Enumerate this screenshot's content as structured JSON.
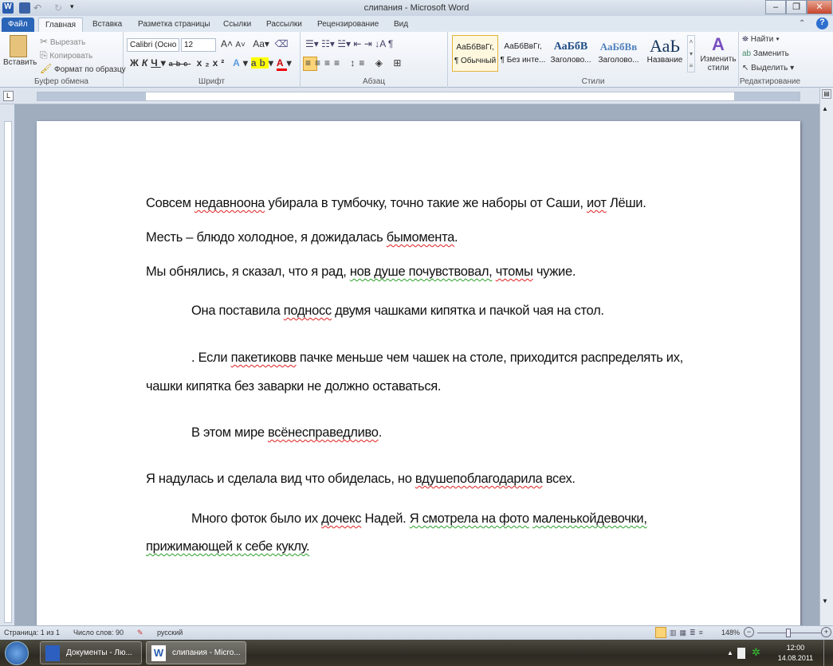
{
  "window": {
    "title": "слипания - Microsoft Word",
    "minimize": "–",
    "restore": "❐",
    "close": "✕"
  },
  "tabs": [
    "Файл",
    "Главная",
    "Вставка",
    "Разметка страницы",
    "Ссылки",
    "Рассылки",
    "Рецензирование",
    "Вид"
  ],
  "ribbon": {
    "clipboard": {
      "label": "Буфер обмена",
      "paste": "Вставить",
      "cut": "Вырезать",
      "copy": "Копировать",
      "format_painter": "Формат по образцу"
    },
    "font": {
      "label": "Шрифт",
      "font_name": "Calibri (Осно",
      "font_size": "12"
    },
    "paragraph": {
      "label": "Абзац"
    },
    "styles": {
      "label": "Стили",
      "items": [
        {
          "preview": "АаБбВвГг,",
          "name": "¶ Обычный"
        },
        {
          "preview": "АаБбВвГг,",
          "name": "¶ Без инте..."
        },
        {
          "preview": "АаБбВ",
          "name": "Заголово..."
        },
        {
          "preview": "АаБбВв",
          "name": "Заголово..."
        },
        {
          "preview": "АаЬ",
          "name": "Название"
        }
      ],
      "change_styles": "Изменить стили"
    },
    "editing": {
      "label": "Редактирование",
      "find": "Найти",
      "replace": "Заменить",
      "select": "Выделить"
    }
  },
  "document": {
    "lines": [
      {
        "indent": false,
        "segments": [
          {
            "t": "Совсем "
          },
          {
            "t": "недавноона",
            "err": "red"
          },
          {
            "t": " убирала в тумбочку, точно такие же наборы от Саши, "
          },
          {
            "t": "иот",
            "err": "red"
          },
          {
            "t": " Лёши."
          }
        ]
      },
      {
        "indent": false,
        "segments": [
          {
            "t": "Месть – блюдо холодное, я дожидалась "
          },
          {
            "t": "бымомента",
            "err": "red"
          },
          {
            "t": "."
          }
        ]
      },
      {
        "indent": false,
        "segments": [
          {
            "t": "Мы обнялись, я сказал, что я рад, "
          },
          {
            "t": "нов душе почувствовал,",
            "err": "green"
          },
          {
            "t": " "
          },
          {
            "t": "чтомы",
            "err": "red"
          },
          {
            "t": " чужие."
          }
        ]
      },
      {
        "indent": true,
        "segments": [
          {
            "t": "Она поставила "
          },
          {
            "t": "подносс",
            "err": "red"
          },
          {
            "t": " двумя чашками кипятка и пачкой чая на стол."
          }
        ]
      },
      {
        "indent": true,
        "segments": [
          {
            "t": ". Если "
          },
          {
            "t": "пакетиковв",
            "err": "red"
          },
          {
            "t": " пачке меньше чем чашек на столе, приходится распределять их,"
          }
        ]
      },
      {
        "indent": false,
        "segments": [
          {
            "t": "чашки кипятка без заварки не должно оставаться."
          }
        ]
      },
      {
        "indent": true,
        "segments": [
          {
            "t": "В этом мире "
          },
          {
            "t": "всёнесправедливо",
            "err": "red"
          },
          {
            "t": "."
          }
        ]
      },
      {
        "indent": false,
        "segments": [
          {
            "t": "Я надулась и сделала вид что обиделась, но "
          },
          {
            "t": "вдушепоблагодарила",
            "err": "red"
          },
          {
            "t": " всех."
          }
        ]
      },
      {
        "indent": true,
        "segments": [
          {
            "t": "Много фоток было их "
          },
          {
            "t": "дочекс",
            "err": "red"
          },
          {
            "t": " Надей. "
          },
          {
            "t": "Я смотрела на фото",
            "err": "green"
          },
          {
            "t": " "
          },
          {
            "t": "маленькойдевочки,",
            "err": "green"
          }
        ]
      },
      {
        "indent": false,
        "segments": [
          {
            "t": "прижимающей к себе куклу.",
            "err": "green"
          }
        ]
      }
    ]
  },
  "status": {
    "page": "Страница: 1 из 1",
    "words": "Число слов: 90",
    "language": "русский",
    "zoom": "148%"
  },
  "taskbar": {
    "items": [
      "Документы - Лю...",
      "слипания - Micro..."
    ],
    "time": "12:00",
    "date": "14.08.2011"
  }
}
